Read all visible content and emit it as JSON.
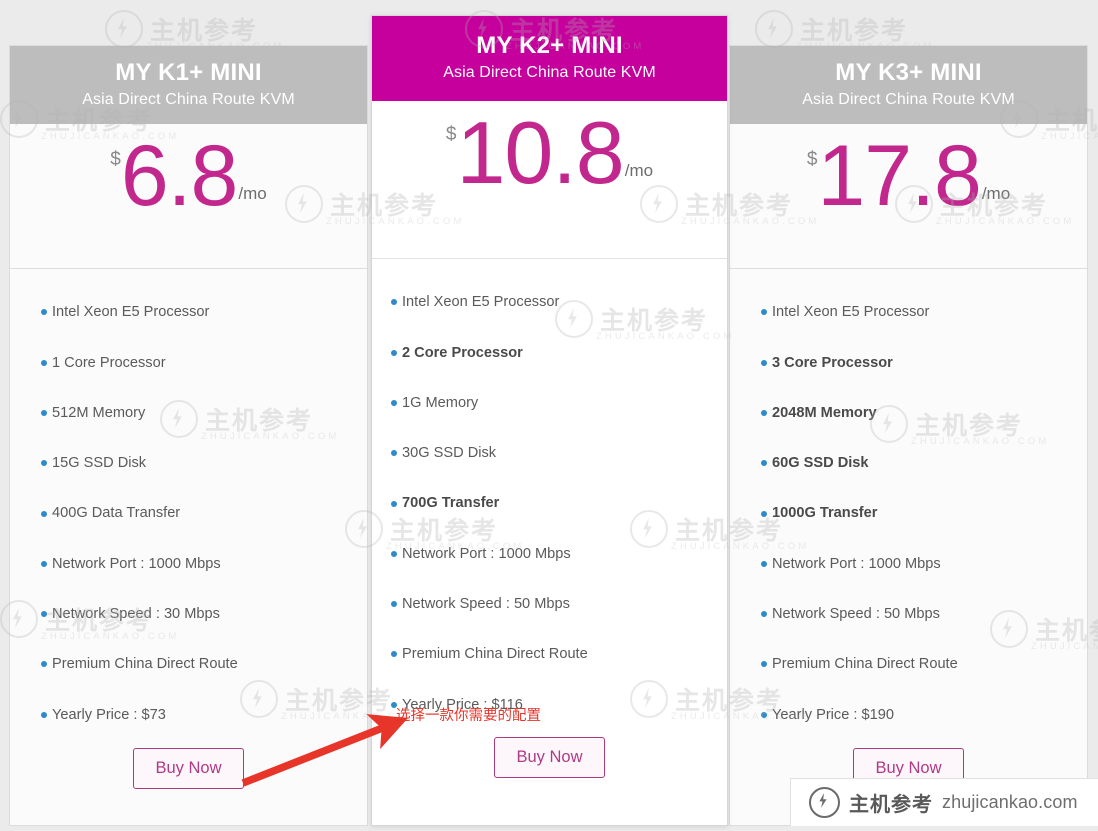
{
  "page": {
    "background_color": "#ebebeb",
    "accent_color": "#c5009c",
    "price_color": "#c2278e",
    "bullet_color": "#2e8bc9",
    "header_gray": "#bdbdbd",
    "annotation_color": "#e8352a"
  },
  "plans": [
    {
      "id": "k1",
      "title": "MY K1+ MINI",
      "subtitle": "Asia Direct China Route KVM",
      "currency": "$",
      "price": "6.8",
      "period": "/mo",
      "featured": false,
      "features": [
        {
          "text": "Intel Xeon E5 Processor",
          "bold": false
        },
        {
          "text": "1 Core Processor",
          "bold": false
        },
        {
          "text": "512M Memory",
          "bold": false
        },
        {
          "text": "15G SSD Disk",
          "bold": false
        },
        {
          "text": "400G Data Transfer",
          "bold": false
        },
        {
          "text": "Network Port : 1000 Mbps",
          "bold": false
        },
        {
          "text": "Network Speed : 30 Mbps",
          "bold": false
        },
        {
          "text": "Premium China Direct Route",
          "bold": false
        },
        {
          "text": "Yearly Price : $73",
          "bold": false
        }
      ],
      "buy_label": "Buy Now"
    },
    {
      "id": "k2",
      "title": "MY K2+ MINI",
      "subtitle": "Asia Direct China Route KVM",
      "currency": "$",
      "price": "10.8",
      "period": "/mo",
      "featured": true,
      "features": [
        {
          "text": "Intel Xeon E5 Processor",
          "bold": false
        },
        {
          "text": "2 Core Processor",
          "bold": true
        },
        {
          "text": "1G Memory",
          "bold": false
        },
        {
          "text": "30G SSD Disk",
          "bold": false
        },
        {
          "text": "700G Transfer",
          "bold": true
        },
        {
          "text": "Network Port : 1000 Mbps",
          "bold": false
        },
        {
          "text": "Network Speed : 50 Mbps",
          "bold": false
        },
        {
          "text": "Premium China Direct Route",
          "bold": false
        },
        {
          "text": "Yearly Price : $116",
          "bold": false
        }
      ],
      "buy_label": "Buy Now"
    },
    {
      "id": "k3",
      "title": "MY K3+ MINI",
      "subtitle": "Asia Direct China Route KVM",
      "currency": "$",
      "price": "17.8",
      "period": "/mo",
      "featured": false,
      "features": [
        {
          "text": "Intel Xeon E5 Processor",
          "bold": false
        },
        {
          "text": "3 Core Processor",
          "bold": true
        },
        {
          "text": "2048M Memory",
          "bold": true
        },
        {
          "text": "60G SSD Disk",
          "bold": true
        },
        {
          "text": "1000G Transfer",
          "bold": true
        },
        {
          "text": "Network Port : 1000 Mbps",
          "bold": false
        },
        {
          "text": "Network Speed : 50 Mbps",
          "bold": false
        },
        {
          "text": "Premium China Direct Route",
          "bold": false
        },
        {
          "text": "Yearly Price : $190",
          "bold": false
        }
      ],
      "buy_label": "Buy Now"
    }
  ],
  "annotation": {
    "text": "选择一款你需要的配置"
  },
  "site_badge": {
    "cn_name": "主机参考",
    "url": "zhujicankao.com"
  },
  "watermark": {
    "cn_name": "主机参考",
    "domain": "ZHUJICANKAO.COM"
  }
}
